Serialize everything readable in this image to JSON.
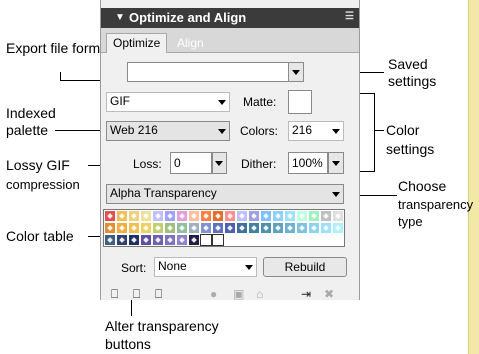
{
  "panel": {
    "title": "Optimize and Align",
    "tabs": [
      "Optimize",
      "Align"
    ],
    "saved_settings_value": "",
    "format_value": "GIF",
    "matte_label": "Matte:",
    "palette_value": "Web 216",
    "colors_label": "Colors:",
    "colors_value": "216",
    "loss_label": "Loss:",
    "loss_value": "0",
    "dither_label": "Dither:",
    "dither_value": "100%",
    "transparency_value": "Alpha Transparency",
    "sort_label": "Sort:",
    "sort_value": "None",
    "rebuild_label": "Rebuild",
    "swatch_colors": [
      "#e05050",
      "#f0c060",
      "#f0d080",
      "#f0e0a0",
      "#c0c0ff",
      "#a0a0ff",
      "#e0a0e0",
      "#ffc0a0",
      "#ff8040",
      "#e07030",
      "#ff9090",
      "#c0c0ff",
      "#a0a0e0",
      "#80c0ff",
      "#90d0ff",
      "#a0e0ff",
      "#c0ffe0",
      "#a0f0c0",
      "#c0c0c0",
      "#e0e0e0",
      "#e09030",
      "#f0b040",
      "#f0c050",
      "#f0d060",
      "#c0d070",
      "#a0c080",
      "#90c0a0",
      "#a0b0c0",
      "#8090d0",
      "#6070c0",
      "#5060b0",
      "#4070a0",
      "#4080a0",
      "#5090b0",
      "#60a0c0",
      "#70b0d0",
      "#80c0e0",
      "#90d0f0",
      "#a0e0ff",
      "#b0f0ff",
      "#406080",
      "#304070",
      "#203060",
      "#6050a0",
      "#7060b0",
      "#8070c0",
      "#9080d0",
      "#202040",
      "#ffffff",
      "#ffffff"
    ]
  },
  "callouts": {
    "export_format": "Export file format",
    "indexed_palette": "Indexed palette",
    "lossy_gif": [
      "Lossy GIF",
      "compression"
    ],
    "color_table": "Color table",
    "alter_transparency": [
      "Alter transparency",
      "buttons"
    ],
    "saved_settings": [
      "Saved",
      "settings"
    ],
    "color_settings": [
      "Color",
      "settings"
    ],
    "choose_transparency": [
      "Choose",
      "transparency",
      "type"
    ]
  }
}
